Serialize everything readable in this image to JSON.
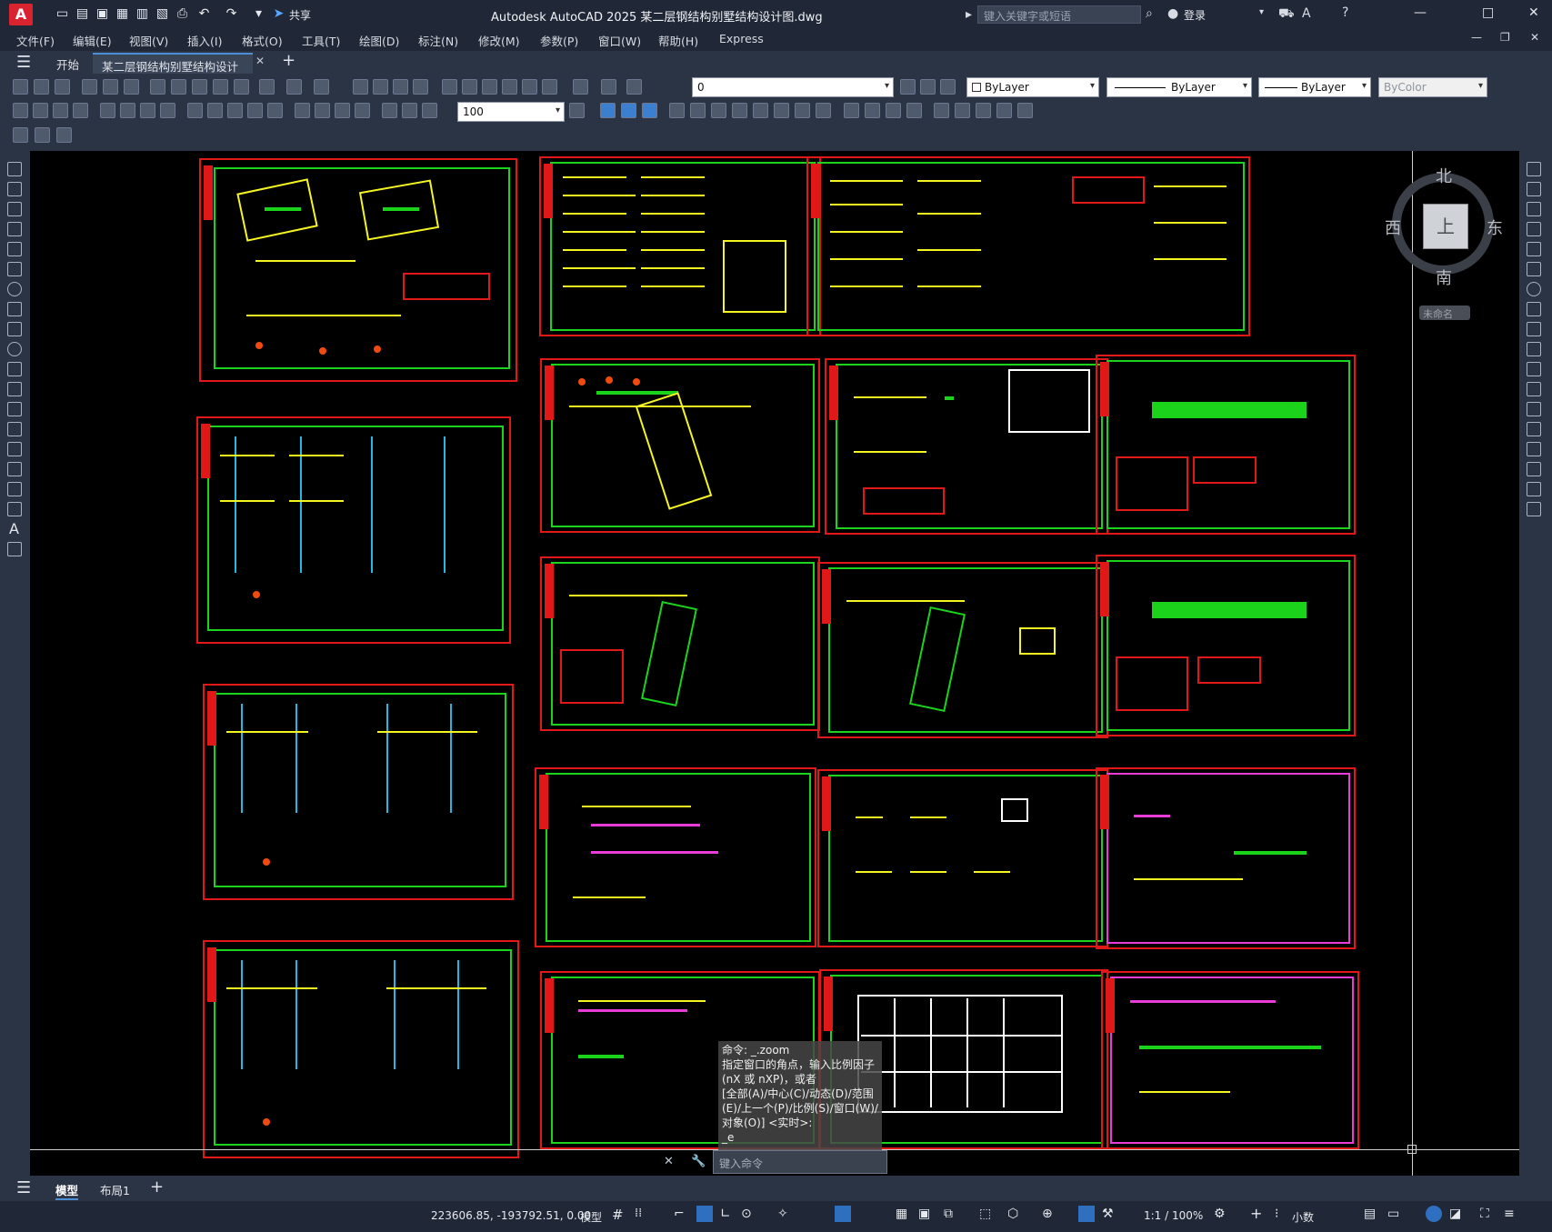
{
  "app": {
    "logo_letter": "A",
    "share_label": "共享",
    "title": "Autodesk AutoCAD 2025    某二层钢结构别墅结构设计图.dwg",
    "search_placeholder": "键入关键字或短语",
    "login_label": "登录",
    "window_controls": {
      "minimize": "—",
      "maximize": "□",
      "close": "✕"
    }
  },
  "menu": {
    "items": [
      "文件(F)",
      "编辑(E)",
      "视图(V)",
      "插入(I)",
      "格式(O)",
      "工具(T)",
      "绘图(D)",
      "标注(N)",
      "修改(M)",
      "参数(P)",
      "窗口(W)",
      "帮助(H)",
      "Express"
    ]
  },
  "tabs": {
    "start": "开始",
    "doc": "某二层钢结构别墅结构设计图*",
    "close": "✕",
    "add": "+"
  },
  "toolbar": {
    "layer_value": "0",
    "color_value": "ByLayer",
    "linetype_value": "ByLayer",
    "lineweight_value": "ByLayer",
    "plotstyle_value": "ByColor",
    "dimscale_value": "100"
  },
  "viewcube": {
    "north": "北",
    "south": "南",
    "east": "东",
    "west": "西",
    "face": "上",
    "ucs_label": "未命名"
  },
  "command": {
    "lines": [
      "命令: _.zoom",
      "指定窗口的角点，输入比例因子 (nX 或 nXP)，或者",
      "[全部(A)/中心(C)/动态(D)/范围(E)/上一个(P)/比例(S)/窗口(W)/对象(O)] <实时>:",
      "_e"
    ],
    "input_placeholder": "键入命令"
  },
  "layouts": {
    "model": "模型",
    "layout1": "布局1",
    "add": "+"
  },
  "status": {
    "coords": "223606.85, -193792.51, 0.00",
    "mode": "模型",
    "scale": "1:1 / 100%",
    "units": "小数"
  },
  "colors": {
    "title_bg": "#202838",
    "panel_bg": "#2b3444",
    "canvas_bg": "#000000",
    "frame_red": "#e01818",
    "frame_green": "#1bd31b",
    "draw_yellow": "#f5f522",
    "draw_magenta": "#e83bd8",
    "draw_cyan": "#26b8e0",
    "accent_blue": "#4d8fd6"
  }
}
